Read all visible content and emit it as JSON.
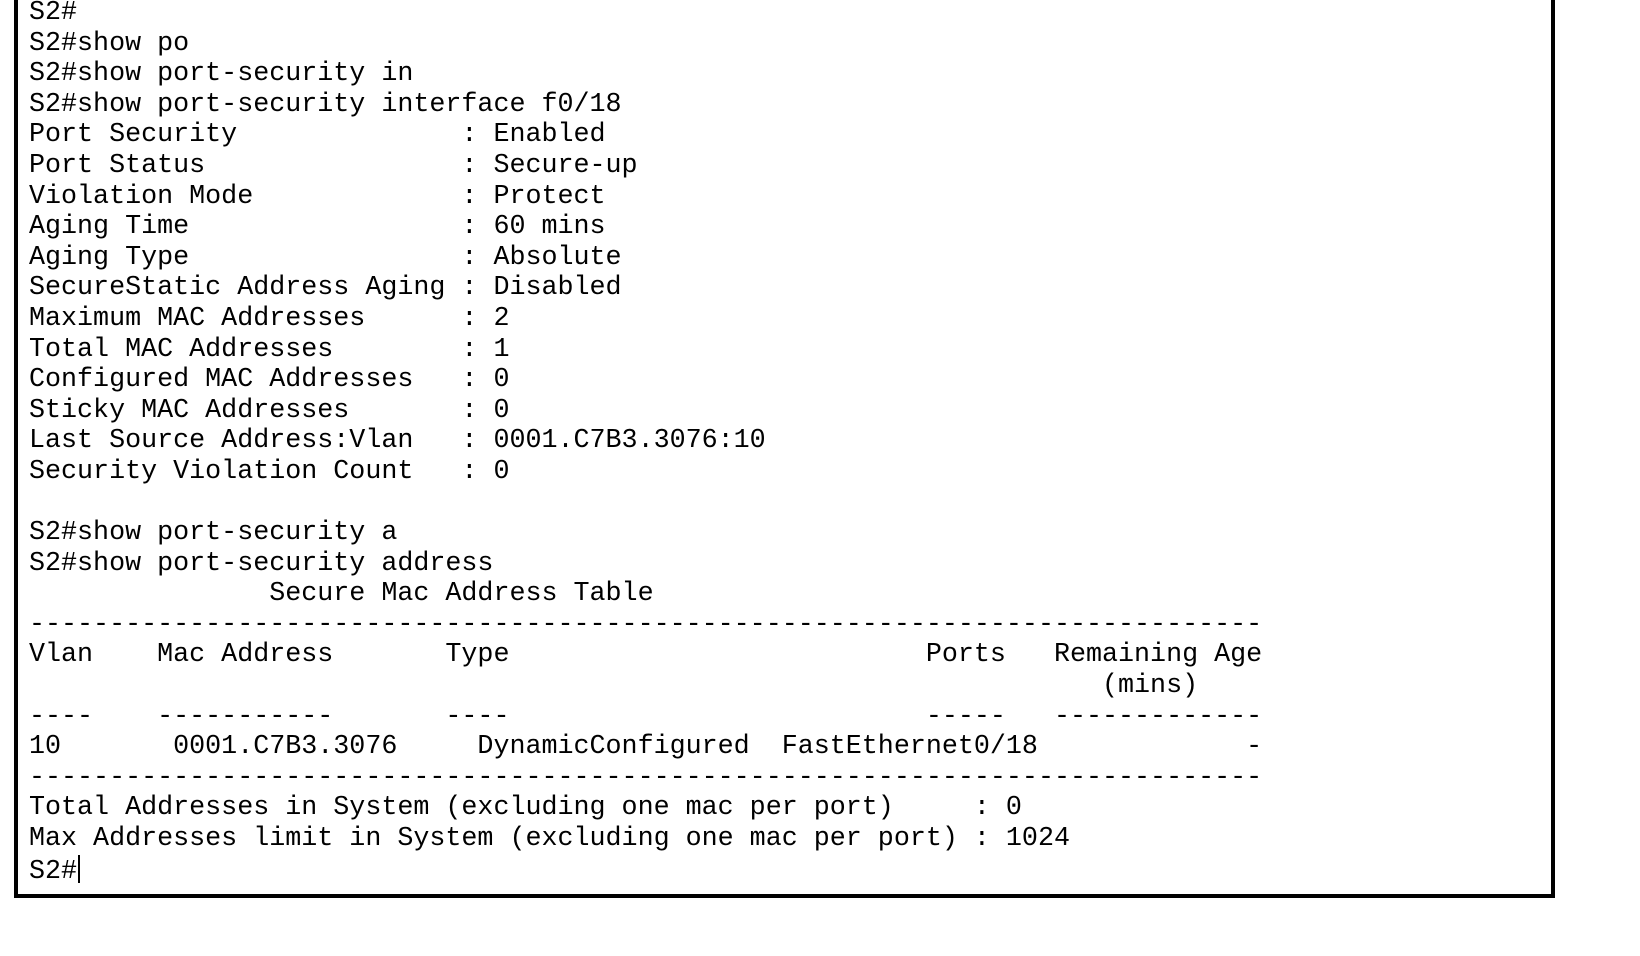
{
  "terminal": {
    "lines": [
      "S2#",
      "S2#show po",
      "S2#show port-security in",
      "S2#show port-security interface f0/18",
      "Port Security              : Enabled",
      "Port Status                : Secure-up",
      "Violation Mode             : Protect",
      "Aging Time                 : 60 mins",
      "Aging Type                 : Absolute",
      "SecureStatic Address Aging : Disabled",
      "Maximum MAC Addresses      : 2",
      "Total MAC Addresses        : 1",
      "Configured MAC Addresses   : 0",
      "Sticky MAC Addresses       : 0",
      "Last Source Address:Vlan   : 0001.C7B3.3076:10",
      "Security Violation Count   : 0",
      "",
      "S2#show port-security a",
      "S2#show port-security address",
      "               Secure Mac Address Table",
      "-----------------------------------------------------------------------------",
      "Vlan    Mac Address       Type                          Ports   Remaining Age",
      "                                                                   (mins)",
      "----    -----------       ----                          -----   -------------",
      "10       0001.C7B3.3076     DynamicConfigured  FastEthernet0/18             -",
      "-----------------------------------------------------------------------------",
      "Total Addresses in System (excluding one mac per port)     : 0",
      "Max Addresses limit in System (excluding one mac per port) : 1024"
    ],
    "prompt": "S2#"
  }
}
